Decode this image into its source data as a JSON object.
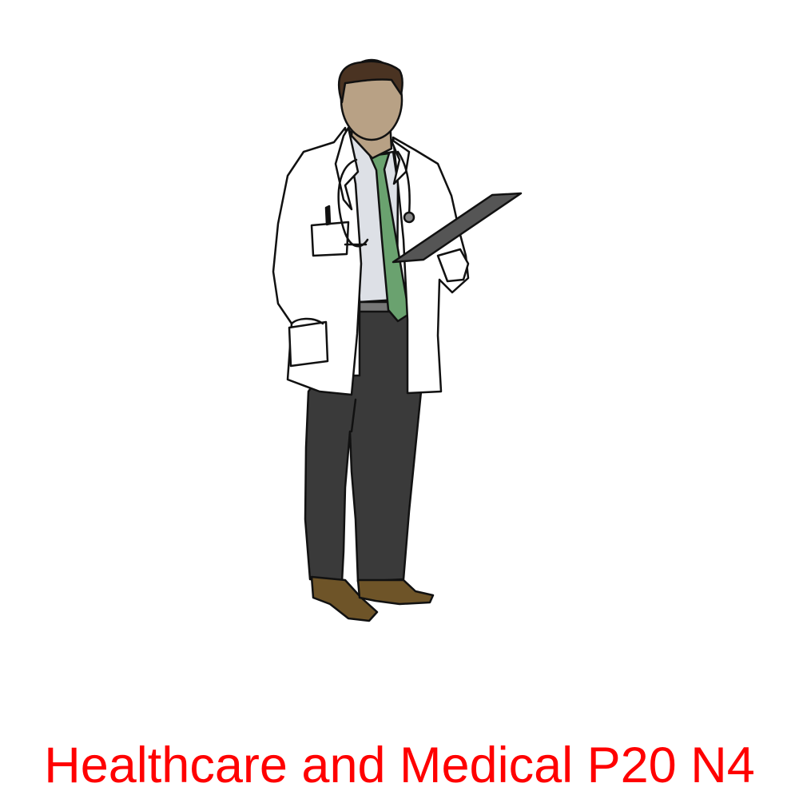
{
  "caption": {
    "text": "Healthcare and Medical P20 N4",
    "color": "#ff0000"
  },
  "illustration": {
    "subject": "doctor-figure",
    "palette": {
      "outline": "#111111",
      "skin": "#b8a185",
      "hair": "#4a3322",
      "coat": "#ffffff",
      "shirt": "#dde0e6",
      "tie": "#6aa26f",
      "trousers": "#3a3a3a",
      "shoes": "#6e5428",
      "clipboard": "#555555",
      "belt": "#777777"
    }
  }
}
